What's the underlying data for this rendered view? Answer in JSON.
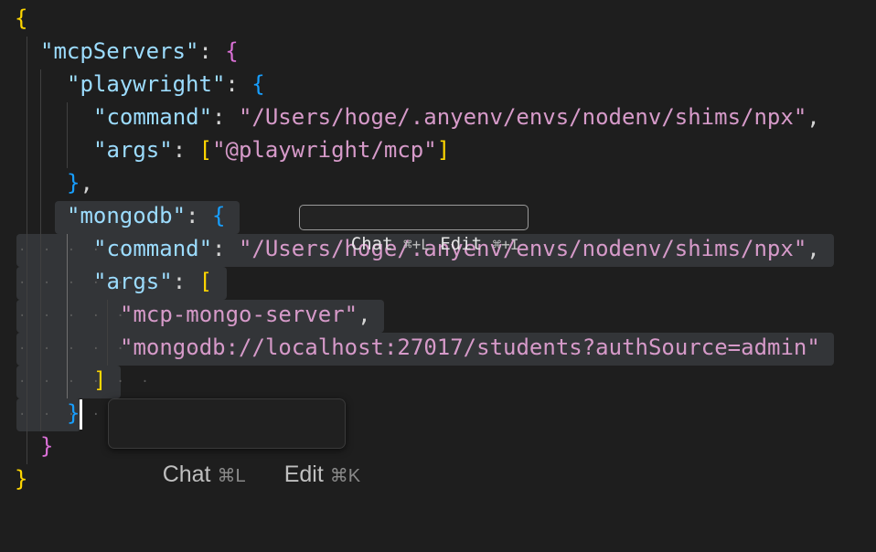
{
  "code": {
    "l1": "{",
    "l2_key": "\"mcpServers\"",
    "l2_sep": ": ",
    "l2_open": "{",
    "l3_key": "\"playwright\"",
    "l3_sep": ": ",
    "l3_open": "{",
    "l4_key": "\"command\"",
    "l4_sep": ": ",
    "l4_val": "\"/Users/hoge/.anyenv/envs/nodenv/shims/npx\"",
    "l4_comma": ",",
    "l5_key": "\"args\"",
    "l5_sep": ": ",
    "l5_open": "[",
    "l5_val": "\"@playwright/mcp\"",
    "l5_close": "]",
    "l6": "}",
    "l6_comma": ",",
    "l7_key": "\"mongodb\"",
    "l7_sep": ": ",
    "l7_open": "{",
    "l8_key": "\"command\"",
    "l8_sep": ": ",
    "l8_val": "\"/Users/hoge/.anyenv/envs/nodenv/shims/npx\"",
    "l8_comma": ",",
    "l9_key": "\"args\"",
    "l9_sep": ": ",
    "l9_open": "[",
    "l10_val": "\"mcp-mongo-server\"",
    "l10_comma": ",",
    "l11_val": "\"mongodb://localhost:27017/students?authSource=admin\"",
    "l12": "]",
    "l13": "}",
    "l14": "}",
    "l15": "}"
  },
  "inline_chip": {
    "chat_label": "Chat",
    "chat_shortcut": "⌘+L",
    "edit_label": "Edit",
    "edit_shortcut": "⌘+I"
  },
  "popup": {
    "chat_label": "Chat",
    "chat_shortcut": "⌘L",
    "edit_label": "Edit",
    "edit_shortcut": "⌘K"
  },
  "colors": {
    "background": "#1e1e1e",
    "bracket_level1": "#ffd700",
    "bracket_level2": "#da70d6",
    "bracket_level3": "#179fff",
    "string": "#d69ac9",
    "key": "#9cdcfe",
    "selection": "#333538"
  }
}
